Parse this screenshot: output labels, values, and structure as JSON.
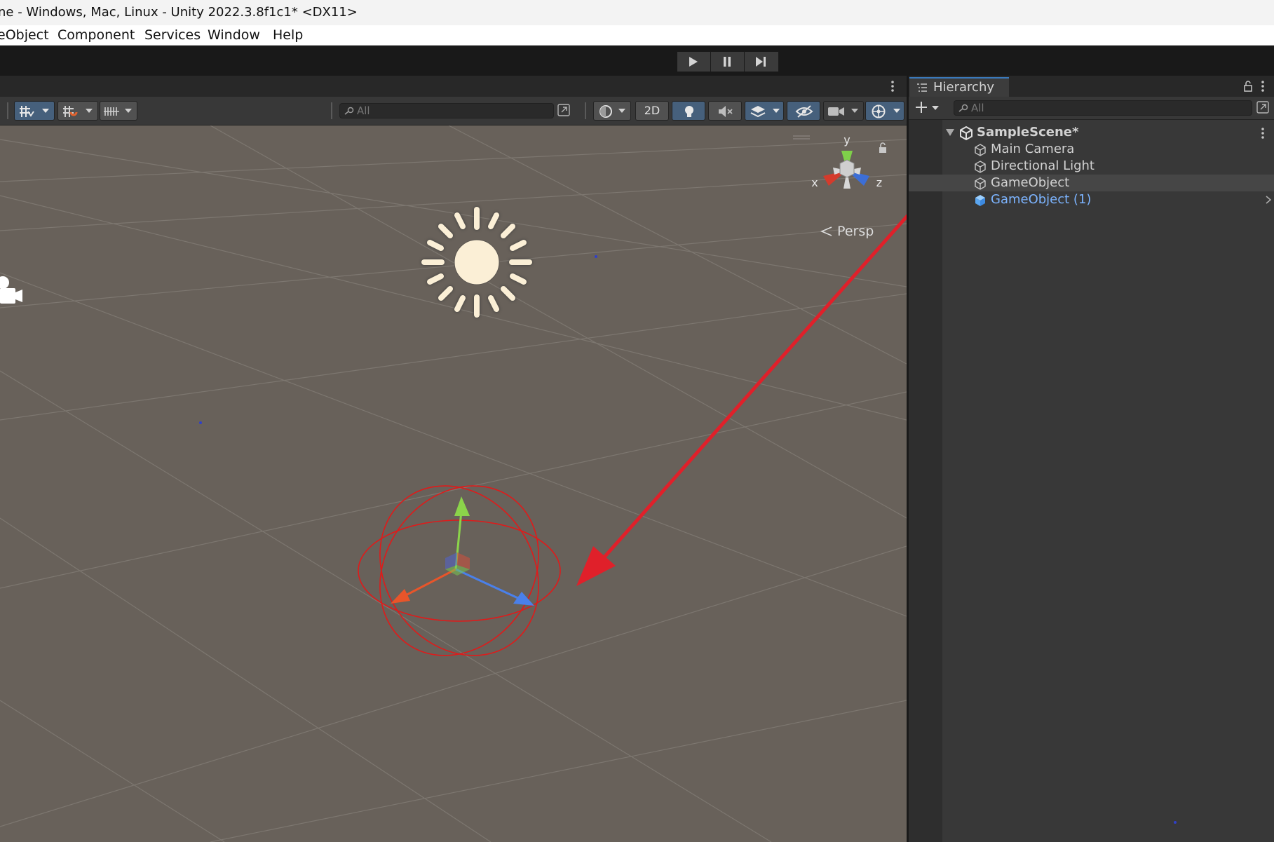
{
  "window": {
    "title": "ne - Windows, Mac, Linux - Unity 2022.3.8f1c1* <DX11>"
  },
  "menu": {
    "items": [
      "eObject",
      "Component",
      "Services",
      "Window",
      "Help"
    ]
  },
  "scene_toolbar": {
    "search_placeholder": "All",
    "mode_2d_label": "2D"
  },
  "viewport": {
    "projection_label": "Persp",
    "gizmo_axes": {
      "x": "x",
      "y": "y",
      "z": "z"
    }
  },
  "hierarchy": {
    "tab_label": "Hierarchy",
    "search_placeholder": "All",
    "scene_name": "SampleScene*",
    "items": [
      {
        "label": "Main Camera",
        "selected": false,
        "prefab": false
      },
      {
        "label": "Directional Light",
        "selected": false,
        "prefab": false
      },
      {
        "label": "GameObject",
        "selected": true,
        "prefab": false
      },
      {
        "label": "GameObject (1)",
        "selected": false,
        "prefab": true
      }
    ]
  },
  "colors": {
    "accent_blue": "#3a79bb",
    "annotation_arrow": "#e0202a",
    "prefab_text": "#7cb4ff"
  },
  "icons": {
    "play": "play-icon",
    "pause": "pause-icon",
    "step": "step-icon",
    "sun": "directional-light-icon",
    "camera": "camera-icon",
    "gameobject": "cube-outline-icon",
    "prefab": "cube-blue-icon"
  }
}
